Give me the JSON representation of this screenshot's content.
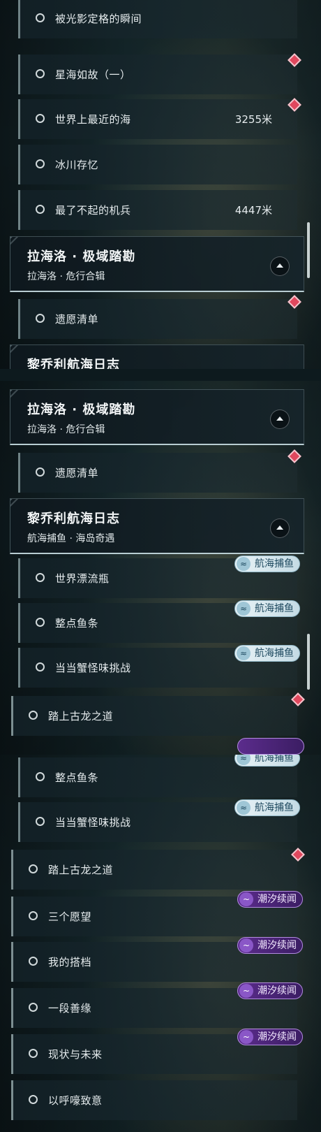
{
  "panel1": {
    "rows": [
      {
        "label": "被光影定格的瞬间",
        "distance": ""
      },
      {
        "label": "星海如故（一）",
        "distance": ""
      },
      {
        "label": "世界上最近的海",
        "distance": "3255米"
      },
      {
        "label": "冰川存忆",
        "distance": ""
      },
      {
        "label": "最了不起的机兵",
        "distance": "4447米"
      }
    ],
    "header": {
      "title": "拉海洛 · 极域踏勘",
      "subtitle": "拉海洛 · 危行合辑"
    },
    "row_after_header": {
      "label": "遗愿清单"
    },
    "partial_header": {
      "title": "黎乔利航海日志"
    }
  },
  "panel2": {
    "header1": {
      "title": "拉海洛 · 极域踏勘",
      "subtitle": "拉海洛 · 危行合辑"
    },
    "row1": {
      "label": "遗愿清单"
    },
    "header2": {
      "title": "黎乔利航海日志",
      "subtitle": "航海捕鱼 · 海岛奇遇"
    },
    "rows": [
      {
        "label": "世界漂流瓶",
        "tag": "航海捕鱼"
      },
      {
        "label": "整点鱼条",
        "tag": "航海捕鱼"
      },
      {
        "label": "当当蟹怪味挑战",
        "tag": "航海捕鱼"
      },
      {
        "label": "踏上古龙之道",
        "tag": ""
      }
    ]
  },
  "panel3": {
    "rows": [
      {
        "label": "整点鱼条",
        "tag": "航海捕鱼"
      },
      {
        "label": "当当蟹怪味挑战",
        "tag": "航海捕鱼"
      },
      {
        "label": "踏上古龙之道",
        "tag": ""
      },
      {
        "label": "三个愿望",
        "tag": "潮汐续闻"
      },
      {
        "label": "我的搭档",
        "tag": "潮汐续闻"
      },
      {
        "label": "一段善缘",
        "tag": "潮汐续闻"
      },
      {
        "label": "现状与未来",
        "tag": "潮汐续闻"
      },
      {
        "label": "以呼嚎致意",
        "tag": ""
      }
    ]
  },
  "icons": {
    "quest": "circle-icon",
    "marker": "red-diamond-icon",
    "fish_tag": "fish-icon",
    "tide_tag": "wave-icon",
    "collapse": "chevron-up-icon"
  },
  "colors": {
    "marker_red": "#e0485e",
    "fish_tag_bg": "#e8f2f6",
    "tide_tag_bg": "#5b2c8c"
  }
}
